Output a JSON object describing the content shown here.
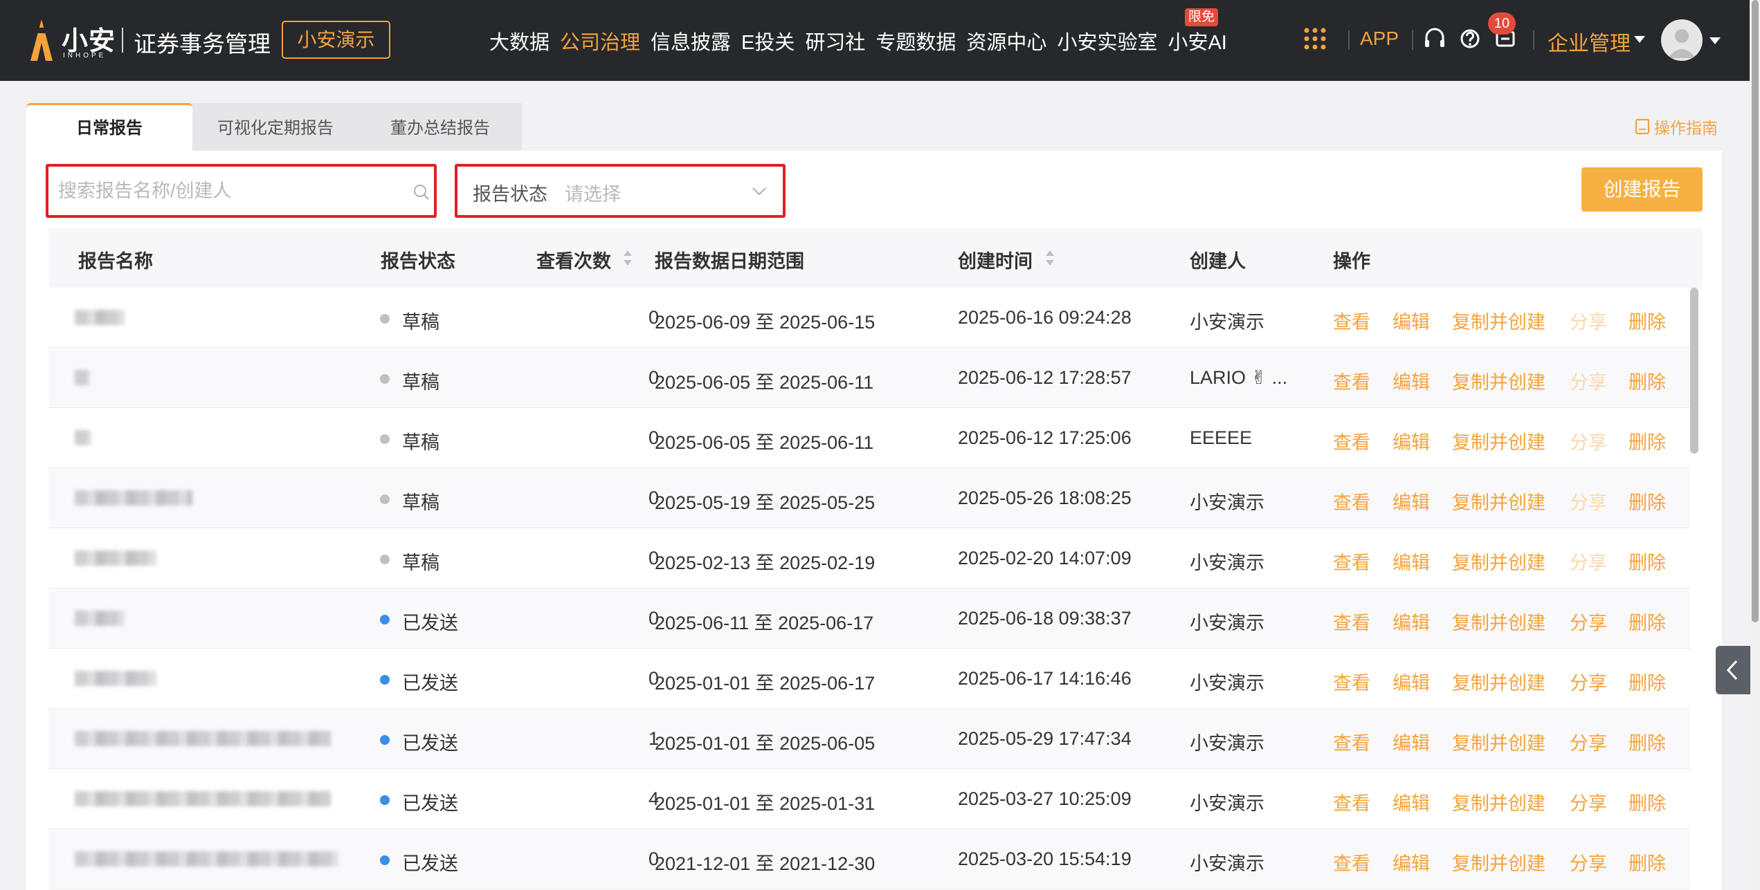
{
  "brand": {
    "name": "小安",
    "sub": "INHOPE",
    "product": "证券事务管理",
    "demo": "小安演示",
    "accent": "#f6a33b"
  },
  "nav": {
    "items": [
      "大数据",
      "公司治理",
      "信息披露",
      "E投关",
      "研习社",
      "专题数据",
      "资源中心",
      "小安实验室",
      "小安AI"
    ],
    "active_index": 1,
    "ai_tag": "限免",
    "app_label": "APP",
    "notification_count": "10",
    "org_menu": "企业管理",
    "icons": [
      "apps-grid-icon",
      "headset-icon",
      "help-icon",
      "message-icon",
      "avatar"
    ]
  },
  "tabs": [
    "日常报告",
    "可视化定期报告",
    "董办总结报告"
  ],
  "guide_label": "操作指南",
  "filters": {
    "search_placeholder": "搜索报告名称/创建人",
    "status_label": "报告状态",
    "status_placeholder": "请选择"
  },
  "create_label": "创建报告",
  "table": {
    "columns": [
      "报告名称",
      "报告状态",
      "查看次数",
      "报告数据日期范围",
      "创建时间",
      "创建人",
      "操作"
    ],
    "rows": [
      {
        "status": "草稿",
        "status_type": "draft",
        "views": "0",
        "range": "2025-06-09 至 2025-06-15",
        "created": "2025-06-16 09:24:28",
        "creator": "小安演示"
      },
      {
        "status": "草稿",
        "status_type": "draft",
        "views": "0",
        "range": "2025-06-05 至 2025-06-11",
        "created": "2025-06-12 17:28:57",
        "creator": "LARIO ✌ ..."
      },
      {
        "status": "草稿",
        "status_type": "draft",
        "views": "0",
        "range": "2025-06-05 至 2025-06-11",
        "created": "2025-06-12 17:25:06",
        "creator": "EEEEE"
      },
      {
        "status": "草稿",
        "status_type": "draft",
        "views": "0",
        "range": "2025-05-19 至 2025-05-25",
        "created": "2025-05-26 18:08:25",
        "creator": "小安演示"
      },
      {
        "status": "草稿",
        "status_type": "draft",
        "views": "0",
        "range": "2025-02-13 至 2025-02-19",
        "created": "2025-02-20 14:07:09",
        "creator": "小安演示"
      },
      {
        "status": "已发送",
        "status_type": "sent",
        "views": "0",
        "range": "2025-06-11 至 2025-06-17",
        "created": "2025-06-18 09:38:37",
        "creator": "小安演示"
      },
      {
        "status": "已发送",
        "status_type": "sent",
        "views": "0",
        "range": "2025-01-01 至 2025-06-17",
        "created": "2025-06-17 14:16:46",
        "creator": "小安演示"
      },
      {
        "status": "已发送",
        "status_type": "sent",
        "views": "1",
        "range": "2025-01-01 至 2025-06-05",
        "created": "2025-05-29 17:47:34",
        "creator": "小安演示"
      },
      {
        "status": "已发送",
        "status_type": "sent",
        "views": "4",
        "range": "2025-01-01 至 2025-01-31",
        "created": "2025-03-27 10:25:09",
        "creator": "小安演示"
      },
      {
        "status": "已发送",
        "status_type": "sent",
        "views": "0",
        "range": "2021-12-01 至 2021-12-30",
        "created": "2025-03-20 15:54:19",
        "creator": "小安演示"
      }
    ],
    "actions": [
      "查看",
      "编辑",
      "复制并创建",
      "分享",
      "删除"
    ],
    "status_colors": {
      "draft": "#c0c0c0",
      "sent": "#3a8ee6"
    }
  }
}
